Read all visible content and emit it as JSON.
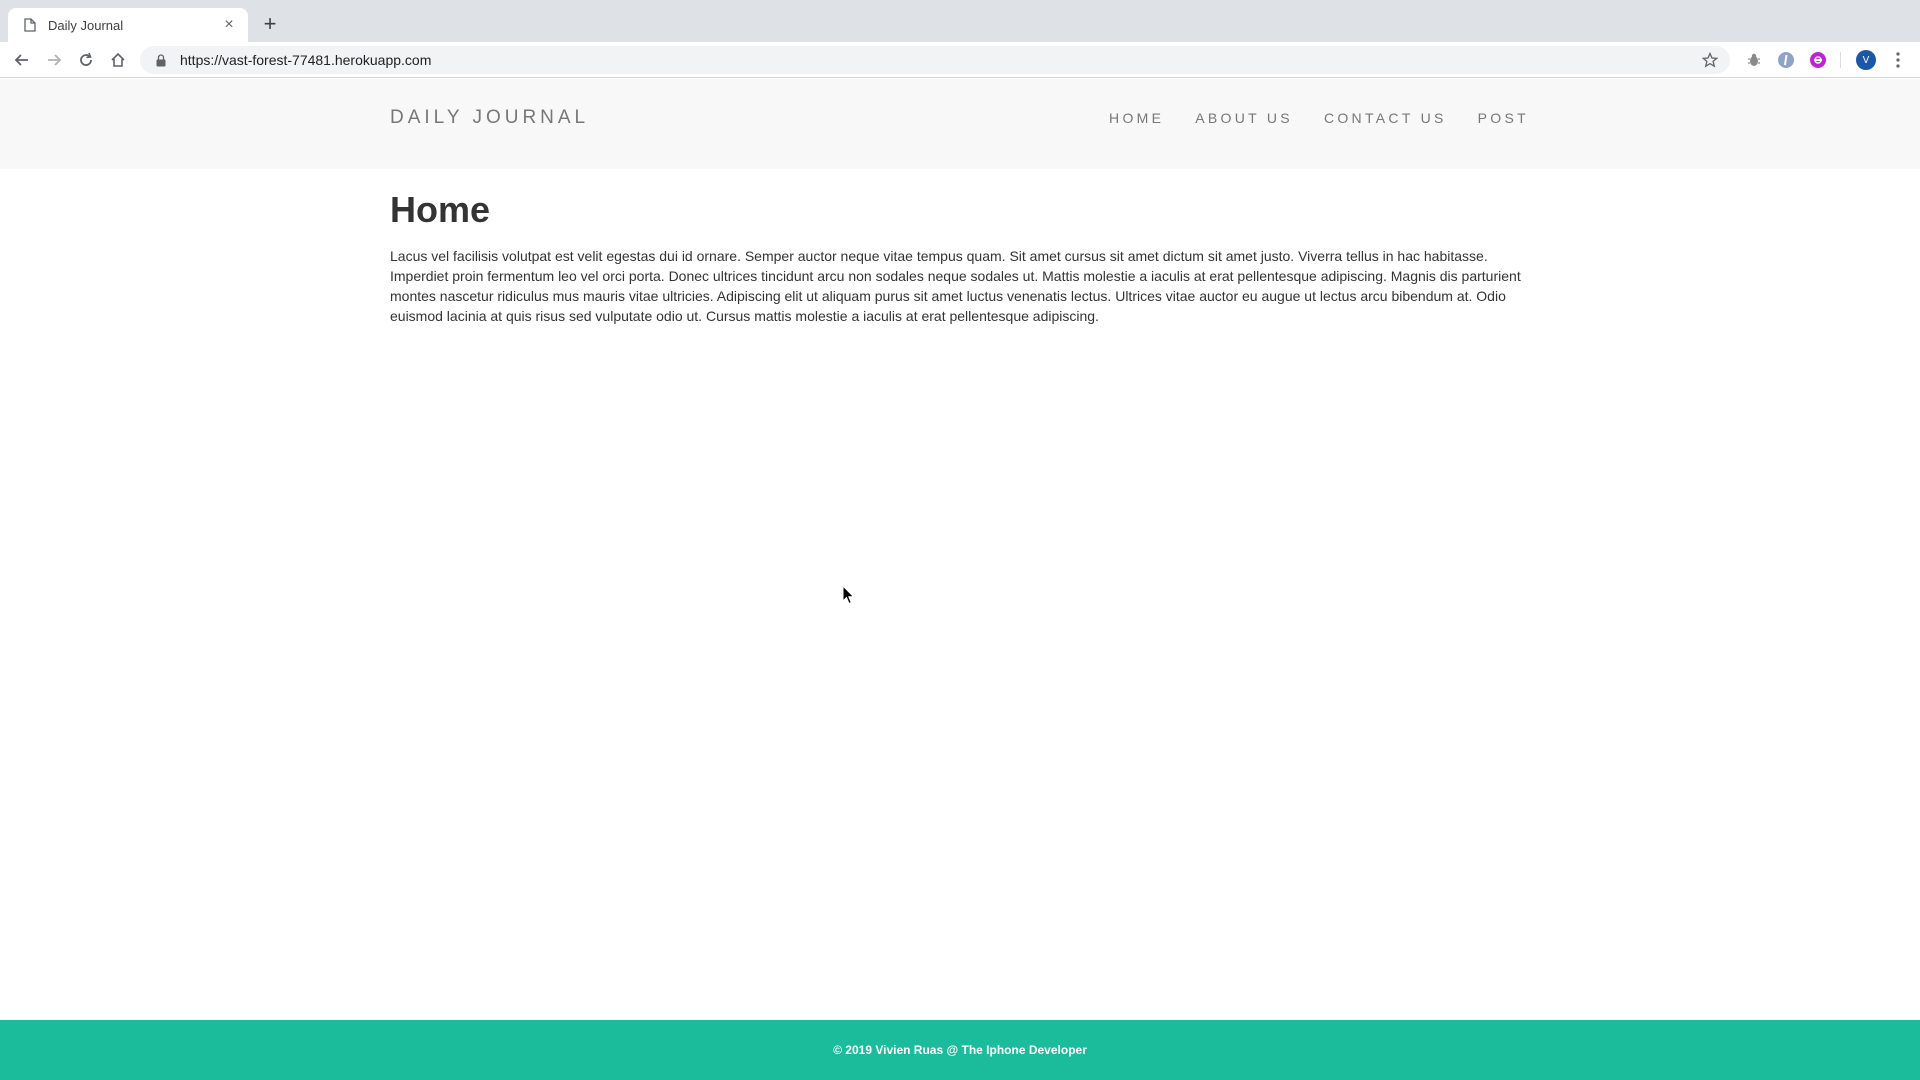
{
  "browser": {
    "tab": {
      "title": "Daily Journal",
      "favicon": "page-icon",
      "close": "×"
    },
    "new_tab": "+",
    "toolbar": {
      "back": "back-arrow-icon",
      "forward": "forward-arrow-icon",
      "reload": "reload-icon",
      "home": "home-icon",
      "url": "https://vast-forest-77481.herokuapp.com",
      "bookmark": "star-icon",
      "extensions": [
        "bug-extension-icon",
        "info-extension-icon",
        "purple-extension-icon"
      ],
      "profile_initial": "V",
      "menu": "more-vert-icon"
    }
  },
  "site": {
    "brand": "DAILY JOURNAL",
    "nav": [
      {
        "label": "HOME"
      },
      {
        "label": "ABOUT US"
      },
      {
        "label": "CONTACT US"
      },
      {
        "label": "POST"
      }
    ]
  },
  "main": {
    "title": "Home",
    "body": "Lacus vel facilisis volutpat est velit egestas dui id ornare. Semper auctor neque vitae tempus quam. Sit amet cursus sit amet dictum sit amet justo. Viverra tellus in hac habitasse. Imperdiet proin fermentum leo vel orci porta. Donec ultrices tincidunt arcu non sodales neque sodales ut. Mattis molestie a iaculis at erat pellentesque adipiscing. Magnis dis parturient montes nascetur ridiculus mus mauris vitae ultricies. Adipiscing elit ut aliquam purus sit amet luctus venenatis lectus. Ultrices vitae auctor eu augue ut lectus arcu bibendum at. Odio euismod lacinia at quis risus sed vulputate odio ut. Cursus mattis molestie a iaculis at erat pellentesque adipiscing."
  },
  "footer": {
    "text": "© 2019 Vivien Ruas @ The Iphone Developer"
  },
  "colors": {
    "footer_bg": "#1abc9c",
    "header_bg": "#f8f8f8",
    "nav_text": "#777777",
    "title_text": "#333333"
  }
}
